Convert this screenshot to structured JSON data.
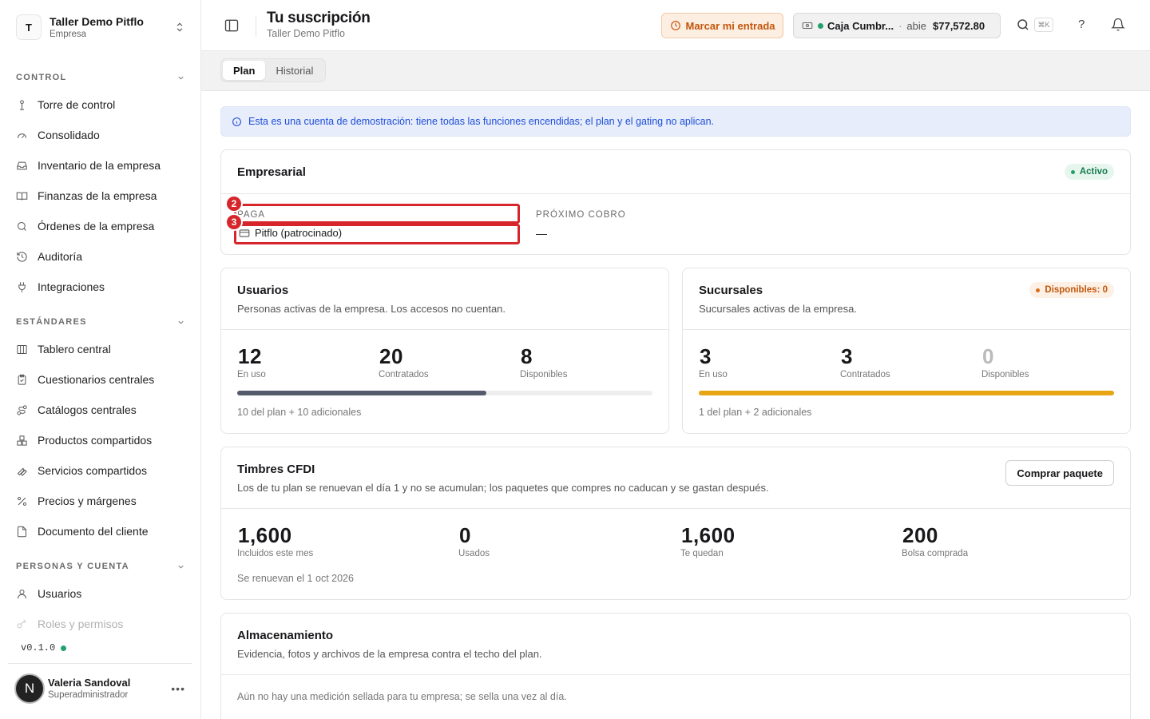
{
  "workspace": {
    "initial": "T",
    "name": "Taller Demo Pitflo",
    "type": "Empresa"
  },
  "sidebar": {
    "sections": [
      {
        "label": "CONTROL",
        "items": [
          "Torre de control",
          "Consolidado",
          "Inventario de la empresa",
          "Finanzas de la empresa",
          "Órdenes de la empresa",
          "Auditoría",
          "Integraciones"
        ]
      },
      {
        "label": "ESTÁNDARES",
        "items": [
          "Tablero central",
          "Cuestionarios centrales",
          "Catálogos centrales",
          "Productos compartidos",
          "Servicios compartidos",
          "Precios y márgenes",
          "Documento del cliente"
        ]
      },
      {
        "label": "PERSONAS Y CUENTA",
        "items": [
          "Usuarios",
          "Roles y permisos"
        ]
      }
    ],
    "version": "v0.1.0",
    "user": {
      "initial": "N",
      "name": "Valeria Sandoval",
      "role": "Superadministrador"
    }
  },
  "header": {
    "title": "Tu suscripción",
    "subtitle": "Taller Demo Pitflo",
    "entrada_label": "Marcar mi entrada",
    "caja": {
      "name": "Caja Cumbr...",
      "status": "abie",
      "amount": "$77,572.80"
    },
    "shortcut": "⌘K",
    "help": "?"
  },
  "tabs": [
    "Plan",
    "Historial"
  ],
  "banner": "Esta es una cuenta de demostración: tiene todas las funciones encendidas; el plan y el gating no aplican.",
  "plan": {
    "name": "Empresarial",
    "status": "Activo",
    "paga_label": "PAGA",
    "paga_value": "Pitflo (patrocinado)",
    "cobro_label": "PRÓXIMO COBRO",
    "cobro_value": "—"
  },
  "usuarios": {
    "title": "Usuarios",
    "desc": "Personas activas de la empresa. Los accesos no cuentan.",
    "en_uso": "12",
    "en_uso_label": "En uso",
    "contratados": "20",
    "contratados_label": "Contratados",
    "disponibles": "8",
    "disponibles_label": "Disponibles",
    "usage_fraction": 0.6,
    "note": "10 del plan + 10 adicionales"
  },
  "sucursales": {
    "title": "Sucursales",
    "desc": "Sucursales activas de la empresa.",
    "badge": "Disponibles: 0",
    "en_uso": "3",
    "en_uso_label": "En uso",
    "contratados": "3",
    "contratados_label": "Contratados",
    "disponibles": "0",
    "disponibles_label": "Disponibles",
    "usage_fraction": 1.0,
    "note": "1 del plan + 2 adicionales"
  },
  "timbres": {
    "title": "Timbres CFDI",
    "desc": "Los de tu plan se renuevan el día 1 y no se acumulan; los paquetes que compres no caducan y se gastan después.",
    "button": "Comprar paquete",
    "incluidos": "1,600",
    "incluidos_label": "Incluidos este mes",
    "usados": "0",
    "usados_label": "Usados",
    "quedan": "1,600",
    "quedan_label": "Te quedan",
    "bolsa": "200",
    "bolsa_label": "Bolsa comprada",
    "note": "Se renuevan el 1 oct 2026"
  },
  "almacenamiento": {
    "title": "Almacenamiento",
    "desc": "Evidencia, fotos y archivos de la empresa contra el techo del plan.",
    "note": "Aún no hay una medición sellada para tu empresa; se sella una vez al día."
  },
  "markers": [
    "2",
    "3"
  ],
  "colors": {
    "accent_orange": "#c2560b",
    "success": "#22a06b",
    "warning_bar": "#e8a513",
    "user_bar": "#545b6b",
    "marker_red": "#d7262b",
    "info_blue": "#1d4ed8"
  }
}
